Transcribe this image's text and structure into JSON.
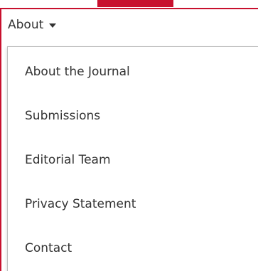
{
  "accent_color": "#c8102e",
  "menu": {
    "toggle_label": "About",
    "caret_icon": "caret-down-icon",
    "items": [
      {
        "label": "About the Journal"
      },
      {
        "label": "Submissions"
      },
      {
        "label": "Editorial Team"
      },
      {
        "label": "Privacy Statement"
      },
      {
        "label": "Contact"
      }
    ]
  }
}
